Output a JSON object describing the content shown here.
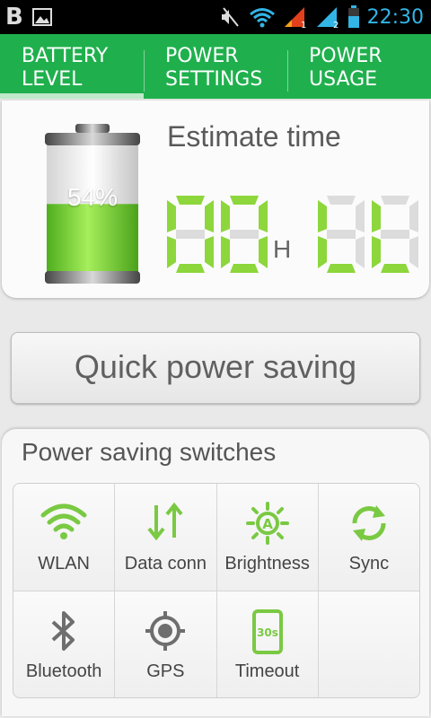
{
  "status_bar": {
    "app_badge": "B",
    "time": "22:30",
    "sim1": "1",
    "sim2": "2"
  },
  "tabs": [
    {
      "label": "BATTERY\nLEVEL",
      "active": true
    },
    {
      "label": "POWER\nSETTINGS",
      "active": false
    },
    {
      "label": "POWER\nUSAGE",
      "active": false
    }
  ],
  "estimate": {
    "battery_percent_label": "54%",
    "battery_level": 0.54,
    "title": "Estimate time",
    "hours": "08",
    "hour_unit": "H",
    "minutes": "88"
  },
  "quick_button_label": "Quick power saving",
  "switches": {
    "title": "Power saving switches",
    "items": [
      {
        "label": "WLAN",
        "icon": "wifi-icon",
        "state": "on"
      },
      {
        "label": "Data conn",
        "icon": "data-connection-icon",
        "state": "on"
      },
      {
        "label": "Brightness",
        "icon": "brightness-auto-icon",
        "state": "on"
      },
      {
        "label": "Sync",
        "icon": "sync-icon",
        "state": "on"
      },
      {
        "label": "Bluetooth",
        "icon": "bluetooth-icon",
        "state": "off"
      },
      {
        "label": "GPS",
        "icon": "gps-icon",
        "state": "off"
      },
      {
        "label": "Timeout",
        "icon": "timeout-icon",
        "state": "on"
      },
      {
        "label": "",
        "icon": "",
        "state": "empty"
      }
    ]
  },
  "colors": {
    "accent_green": "#1fb04d",
    "icon_green": "#7ac943",
    "icon_gray": "#6e6e6e",
    "digit_on": "#8dd63c",
    "digit_off": "#dcdcdc",
    "time_blue": "#32b5e5"
  }
}
